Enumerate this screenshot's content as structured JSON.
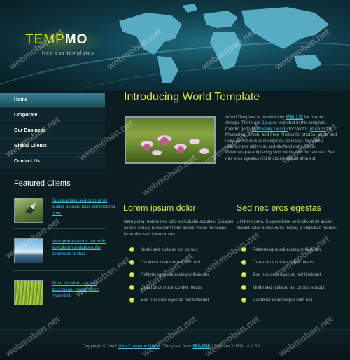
{
  "header": {
    "logo_part1": "TEMP",
    "logo_part2": "MO",
    "tagline": "free css templates"
  },
  "nav": {
    "items": [
      {
        "label": "Home",
        "active": true
      },
      {
        "label": "Corporate",
        "active": false
      },
      {
        "label": "Our Business",
        "active": false
      },
      {
        "label": "Global Clients",
        "active": false
      },
      {
        "label": "Contact Us",
        "active": false
      }
    ]
  },
  "sidebar": {
    "featured_title": "Featured Clients",
    "clients": [
      {
        "text": "Suspendisse sed odio ut mi auctor blandit. Duis consectetur dolo."
      },
      {
        "text": "Nam porta mauris nec odio sollicitudin sodales nulla commodo luctus."
      },
      {
        "text": "Proin tincidunt, arcu id accumsan, neque dolor imperdiet."
      }
    ]
  },
  "main": {
    "intro_title": "Introducing World Template",
    "intro_text_a": "World Template is provided by ",
    "intro_link1": "模板之家",
    "intro_text_b": " for free of charge. There are ",
    "intro_link2": "5 pages",
    "intro_text_c": " included in this template. Credits go to ",
    "intro_link3": "MacDaddy Design",
    "intro_text_d": " for Vector, ",
    "intro_link4": "Rozario",
    "intro_text_e": " for Photoshop Brush, and Free Photos for photos. Morbi sed nulla ac est cursus suscipit eu ac lectus. Curabitur ullamcorper nibh nisi, sed eleifend dolor. Hello. Pellentesque adipiscing sollicitudin velit nec aliquet. Sed nec eros egestas nisl tincidunt aliquet at in est.",
    "col1": {
      "heading": "Lorem ipsum dolor",
      "text": "Nam porta mauris nec odio sollicitudin sodales. Quisque cursus urna a nulla commodo luctus. Nunc mi neque, imperdiet sed interdum eu.",
      "items": [
        "Morbi sed nulla ac est cursus",
        "Curabitur ullamcorper nibh nisi",
        "Pellentesque adipiscing sollicitudin",
        "Cras rutrum ullamcorper metus",
        "Sed nec eros egestas nisl tincidunt"
      ]
    },
    "col2": {
      "heading": "Sed nec eros egestas",
      "text": "Ut libero urna. Suspendisse sed odio ut mi auctor blandit. Duis luctus nulla metus, a vulputate mauris.",
      "items": [
        "Pellentesque adipiscing sollicitudin",
        "Cras rutrum ullamcorper metus",
        "Sed nec eros egestas nisl tincidunt",
        "Morbi sed nulla ac est cursus suscipit",
        "Curabitur ullamcorper nibh nisi"
      ]
    }
  },
  "footer": {
    "copyright": "Copyright © 2048 ",
    "company_link": "Your Company Name",
    "sep1": " | Template from ",
    "template_link": "网站模板",
    "sep2": " | Validate XHTML & CSS"
  },
  "watermark": "webmoban.net",
  "colors": {
    "accent": "#d7e84a",
    "link": "#3ec0e0",
    "background": "#0c1d22"
  }
}
